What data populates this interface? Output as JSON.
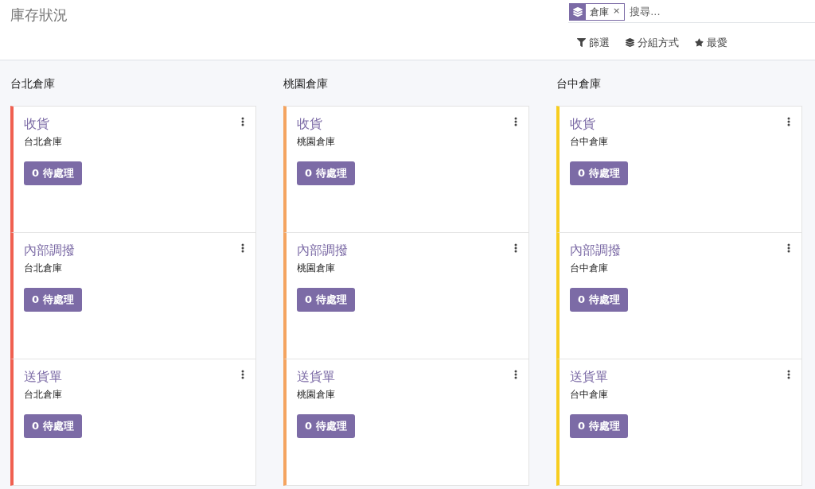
{
  "page_title": "庫存狀況",
  "search": {
    "facet": {
      "label": "倉庫",
      "remove": "×"
    },
    "placeholder": "搜尋..."
  },
  "search_options": [
    {
      "kind": "filter",
      "label": "篩選"
    },
    {
      "kind": "group",
      "label": "分組方式"
    },
    {
      "kind": "favorite",
      "label": "最愛"
    }
  ],
  "columns": [
    {
      "title": "台北倉庫",
      "color": "#f06050",
      "cards": [
        {
          "title": "收貨",
          "warehouse": "台北倉庫",
          "button": "0 待處理"
        },
        {
          "title": "內部調撥",
          "warehouse": "台北倉庫",
          "button": "0 待處理"
        },
        {
          "title": "送貨單",
          "warehouse": "台北倉庫",
          "button": "0 待處理"
        }
      ]
    },
    {
      "title": "桃園倉庫",
      "color": "#f4a460",
      "cards": [
        {
          "title": "收貨",
          "warehouse": "桃園倉庫",
          "button": "0 待處理"
        },
        {
          "title": "內部調撥",
          "warehouse": "桃園倉庫",
          "button": "0 待處理"
        },
        {
          "title": "送貨單",
          "warehouse": "桃園倉庫",
          "button": "0 待處理"
        }
      ]
    },
    {
      "title": "台中倉庫",
      "color": "#f7cd1f",
      "cards": [
        {
          "title": "收貨",
          "warehouse": "台中倉庫",
          "button": "0 待處理"
        },
        {
          "title": "內部調撥",
          "warehouse": "台中倉庫",
          "button": "0 待處理"
        },
        {
          "title": "送貨單",
          "warehouse": "台中倉庫",
          "button": "0 待處理"
        }
      ]
    }
  ]
}
